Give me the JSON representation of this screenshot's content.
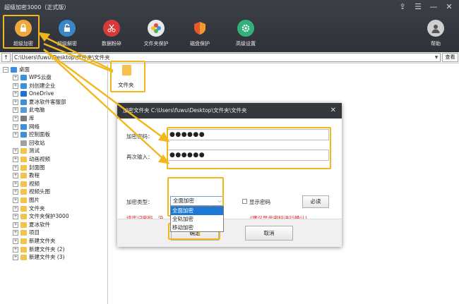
{
  "window": {
    "title": "超级加密3000（正式版）"
  },
  "title_controls": [
    "⇪",
    "☰",
    "—",
    "✕"
  ],
  "toolbar": [
    {
      "label": "超级加密",
      "icon": "lock-icon",
      "color": "#f0a83a"
    },
    {
      "label": "超级解密",
      "icon": "unlock-icon",
      "color": "#3a86c9"
    },
    {
      "label": "数据粉碎",
      "icon": "scissors-icon",
      "color": "#d83a3a"
    },
    {
      "label": "文件夹保护",
      "icon": "flower-icon",
      "color": "#e9e9e9"
    },
    {
      "label": "磁盘保护",
      "icon": "shield-icon",
      "color": "#e8582a"
    },
    {
      "label": "高级设置",
      "icon": "gear-icon",
      "color": "#33b17c"
    },
    {
      "label": "帮助",
      "icon": "user-icon",
      "color": "#cfcfcf"
    }
  ],
  "address_bar": {
    "up_label": "↑",
    "path": "C:\\Users\\fuwu\\Desktop\\文件夹\\文件夹",
    "view_button": "查看"
  },
  "tree": {
    "root": "桌面",
    "items": [
      "WPS云盘",
      "刘创建企业",
      "OneDrive",
      "夏冰软件客服部",
      "此电脑",
      "库",
      "网络",
      "控制面板",
      "回收站",
      "测试",
      "动画视频",
      "封面图",
      "教程",
      "视频",
      "视频头图",
      "图片",
      "文件夹",
      "文件夹保护3000",
      "夏冰软件",
      "项目",
      "新建文件夹",
      "新建文件夹 (2)",
      "新建文件夹 (3)"
    ]
  },
  "file_pane": {
    "folder_name": "文件夹"
  },
  "dialog": {
    "title": "加密文件夹 C:\\Users\\fuwu\\Desktop\\文件夹\\文件夹",
    "close_label": "✕",
    "password_label": "加密密码：",
    "password_value": "●●●●●●",
    "confirm_label": "再次输入：",
    "confirm_value": "●●●●●●",
    "type_label": "加密类型：",
    "type_selected": "全面加密",
    "type_options": [
      "全面加密",
      "全轨加密",
      "移动加密"
    ],
    "show_password_label": "显示密码",
    "must_read_button": "必读",
    "warning_left": "请牢记密码。没",
    "warning_right": "(建议显示密码进行确认)",
    "ok_button": "确定",
    "cancel_button": "取消"
  },
  "colors": {
    "highlight": "#f2b71b",
    "warning": "#d9261c",
    "selected_option": "#1e79d6"
  }
}
